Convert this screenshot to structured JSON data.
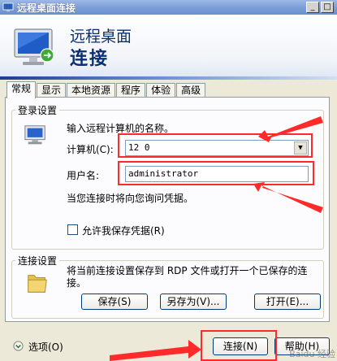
{
  "window": {
    "title": "远程桌面连接",
    "minimize_label": "_",
    "restore_label": "□"
  },
  "banner": {
    "line1": "远程桌面",
    "line2": "连接"
  },
  "tabs": [
    {
      "label": "常规"
    },
    {
      "label": "显示"
    },
    {
      "label": "本地资源"
    },
    {
      "label": "程序"
    },
    {
      "label": "体验"
    },
    {
      "label": "高级"
    }
  ],
  "login": {
    "legend": "登录设置",
    "instruction": "输入远程计算机的名称。",
    "computer_label": "计算机(C):",
    "computer_value": "12        0",
    "username_label": "用户名:",
    "username_value": "administrator",
    "credential_note": "当您连接时将向您询问凭据。",
    "save_credentials_label": "允许我保存凭据(R)"
  },
  "connection": {
    "legend": "连接设置",
    "description": "将当前连接设置保存到 RDP 文件或打开一个已保存的连接。",
    "save_label": "保存(S)",
    "save_as_label": "另存为(V)...",
    "open_label": "打开(E)..."
  },
  "footer": {
    "options_label": "选项(O)",
    "connect_label": "连接(N)",
    "help_label": "帮助(H)",
    "watermark": "Baidu 经验"
  },
  "colors": {
    "annotation": "#ff2a2a",
    "title_text": "#0b2f74"
  }
}
